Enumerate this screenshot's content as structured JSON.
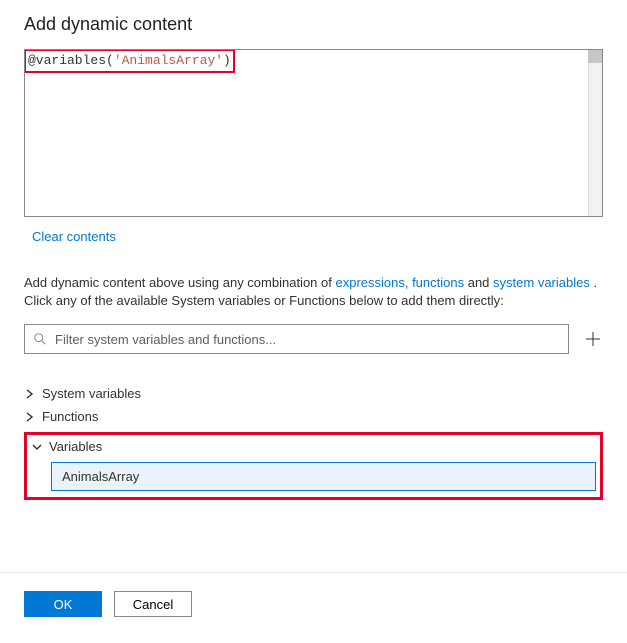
{
  "title": "Add dynamic content",
  "editor": {
    "prefix": "@variables(",
    "arg_quoted": "'AnimalsArray'",
    "suffix": ")"
  },
  "clear_label": "Clear contents",
  "hint": {
    "pre": "Add dynamic content above using any combination of ",
    "link1": "expressions, functions",
    "mid": " and ",
    "link2": "system variables",
    "post1": " .",
    "line2": "Click any of the available System variables or Functions below to add them directly:"
  },
  "filter": {
    "placeholder": "Filter system variables and functions..."
  },
  "tree": {
    "sysvars_label": "System variables",
    "functions_label": "Functions",
    "variables_label": "Variables",
    "variables_items": [
      "AnimalsArray"
    ]
  },
  "footer": {
    "ok": "OK",
    "cancel": "Cancel"
  }
}
